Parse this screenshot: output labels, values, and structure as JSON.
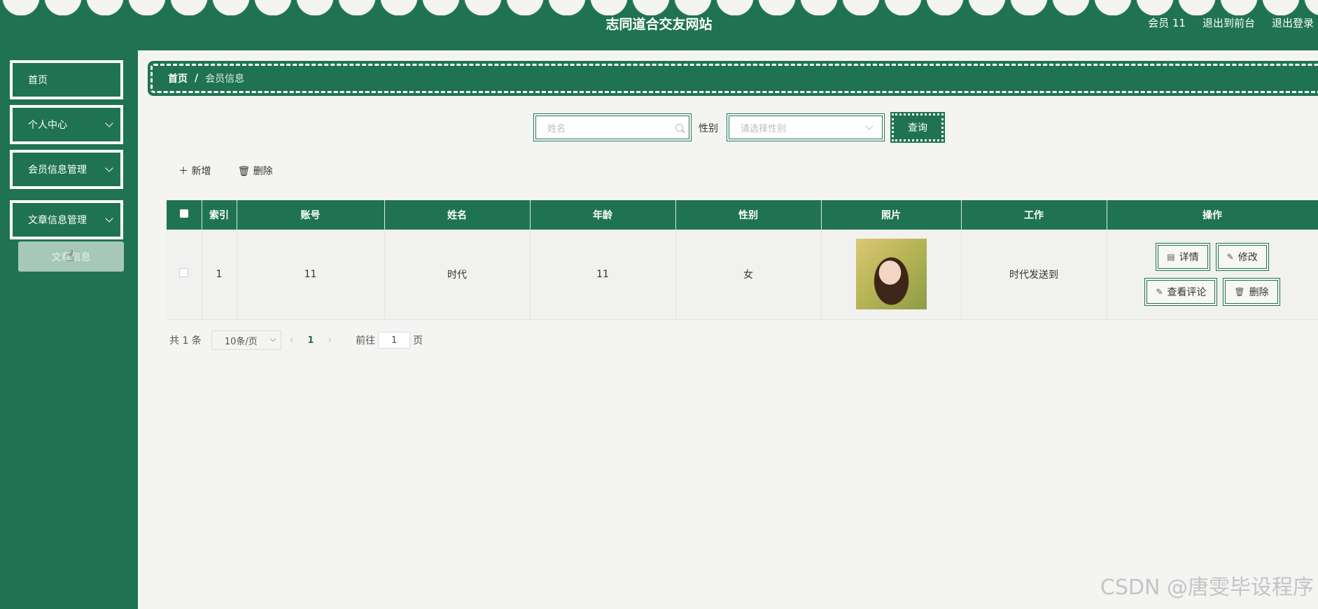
{
  "header": {
    "title": "志同道合交友网站",
    "user": "会员 11",
    "front": "退出到前台",
    "logout": "退出登录",
    "color": "#1f7352"
  },
  "sidebar": {
    "items": [
      {
        "label": "首页",
        "expandable": false
      },
      {
        "label": "个人中心",
        "expandable": true
      },
      {
        "label": "会员信息管理",
        "expandable": true
      },
      {
        "label": "文章信息管理",
        "expandable": true
      }
    ],
    "submenu": "文章信息"
  },
  "breadcrumb": {
    "home": "首页",
    "sep": "/",
    "current": "会员信息"
  },
  "search": {
    "name_placeholder": "姓名",
    "gender_label": "性别",
    "gender_placeholder": "请选择性别",
    "query": "查询"
  },
  "toolbar": {
    "add": "新增",
    "delete": "删除"
  },
  "table": {
    "headers": [
      "索引",
      "账号",
      "姓名",
      "年龄",
      "性别",
      "照片",
      "工作",
      "操作"
    ],
    "rows": [
      {
        "index": "1",
        "account": "11",
        "name": "时代",
        "age": "11",
        "gender": "女",
        "photo": "portrait-photo",
        "job": "时代发送到"
      }
    ],
    "actions": {
      "detail": "详情",
      "edit": "修改",
      "comments": "查看评论",
      "delete": "删除"
    }
  },
  "pager": {
    "total": "共 1 条",
    "size": "10条/页",
    "page": "1",
    "goto": "前往",
    "goto_value": "1",
    "page_unit": "页"
  },
  "watermark": "CSDN @唐雯毕设程序"
}
